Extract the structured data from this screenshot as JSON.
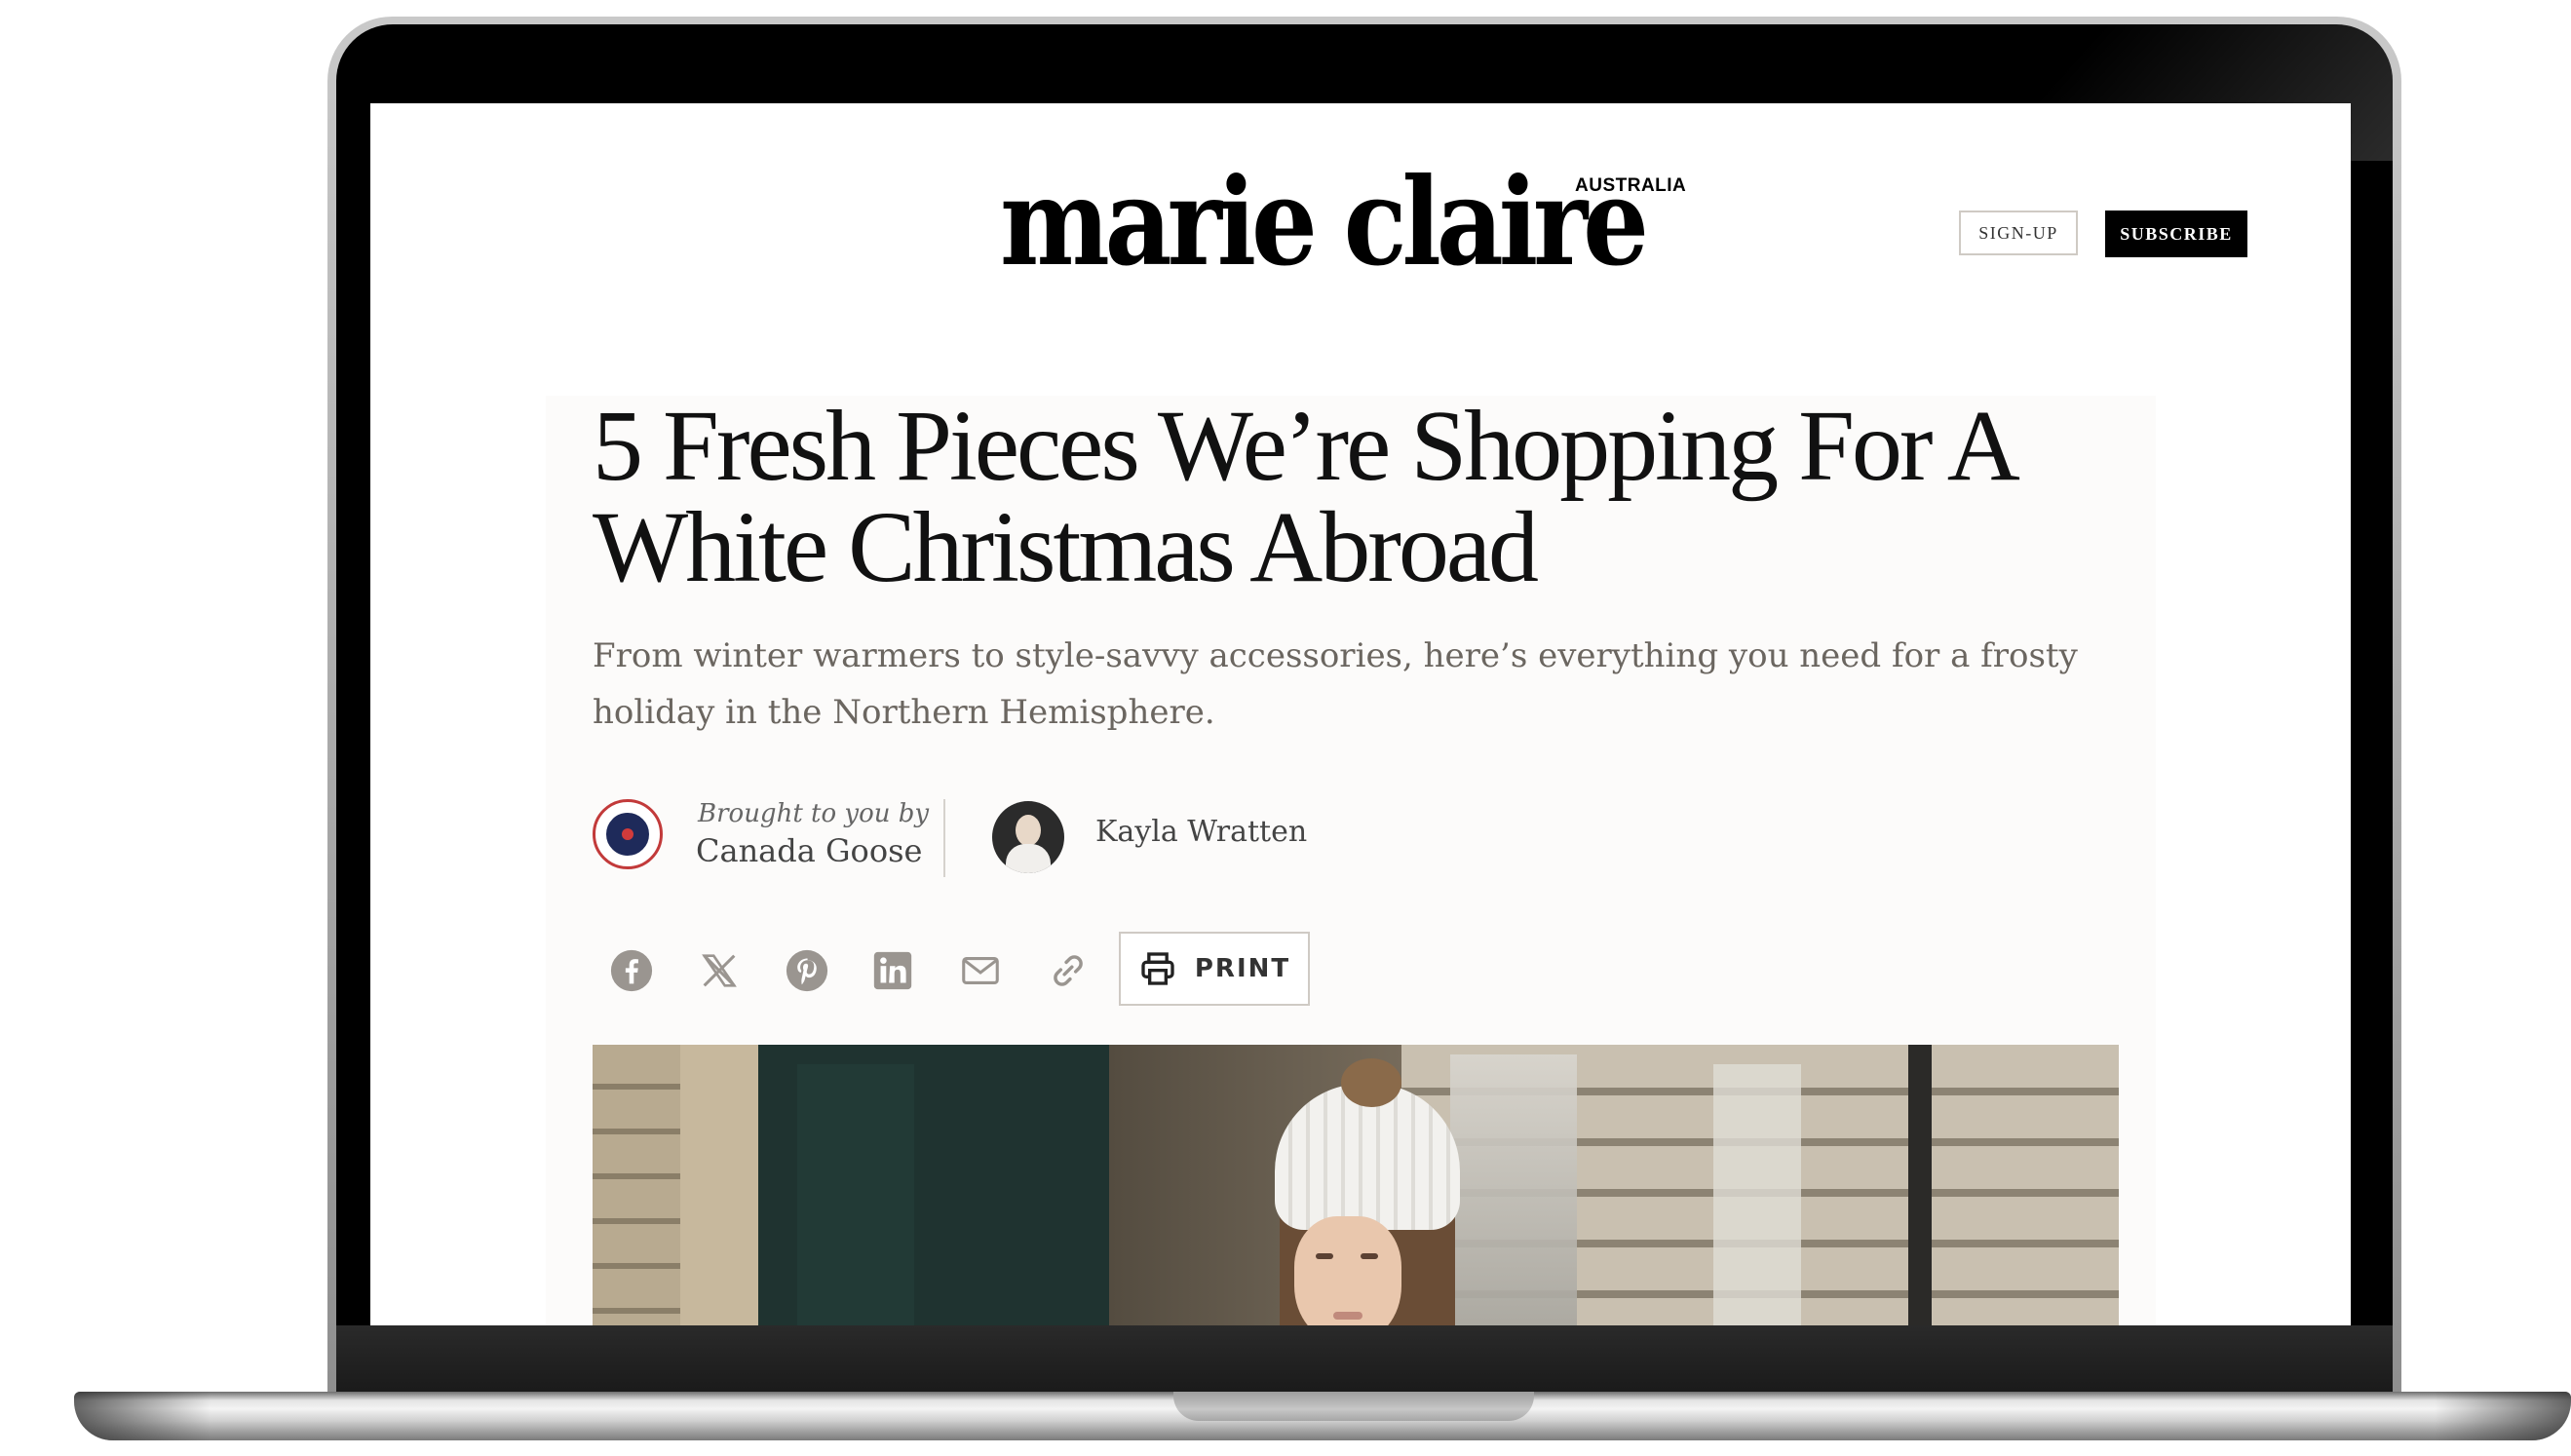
{
  "site": {
    "logo_text": "marie claire",
    "logo_sub": "AUSTRALIA",
    "signup_label": "SIGN-UP",
    "subscribe_label": "SUBSCRIBE"
  },
  "article": {
    "headline_line1": "5 Fresh Pieces We’re Shopping For A",
    "headline_line2": "White Christmas Abroad",
    "standfirst": "From winter warmers to style-savvy accessories, here’s everything you need for a frosty holiday in the Northern Hemisphere.",
    "sponsor": {
      "label": "Brought to you by",
      "name": "Canada Goose"
    },
    "author": {
      "name": "Kayla Wratten"
    },
    "share": {
      "icons": [
        "facebook-icon",
        "x-icon",
        "pinterest-icon",
        "linkedin-icon",
        "email-icon",
        "link-icon"
      ],
      "print_label": "PRINT"
    }
  },
  "colors": {
    "accent": "#000000",
    "share_icon": "#9a9590",
    "text_muted": "#6b6660"
  }
}
